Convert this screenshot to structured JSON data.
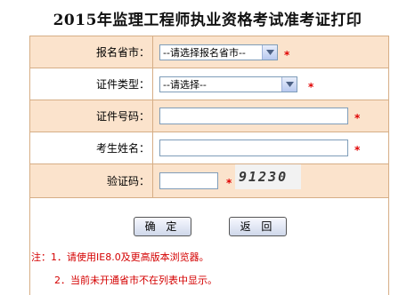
{
  "title": "2015年监理工程师执业资格考试准考证打印",
  "form": {
    "province": {
      "label": "报名省市：",
      "value": "--请选择报名省市--"
    },
    "cert_type": {
      "label": "证件类型：",
      "value": "--请选择--"
    },
    "cert_no": {
      "label": "证件号码：",
      "value": ""
    },
    "name": {
      "label": "考生姓名：",
      "value": ""
    },
    "captcha": {
      "label": "验证码：",
      "value": "",
      "image_text": "91230"
    },
    "required_mark": "*"
  },
  "buttons": {
    "confirm": "确 定",
    "back": "返 回"
  },
  "notes": {
    "line1": "注：1．请使用IE8.0及更高版本浏览器。",
    "line2": "2．当前未开通省市不在列表中显示。"
  },
  "icons": {
    "dropdown": "chevron-down-icon"
  },
  "colors": {
    "label_bg": "#fbe3cc",
    "border": "#d6ae86",
    "required": "#e00000",
    "note": "#d40000"
  }
}
